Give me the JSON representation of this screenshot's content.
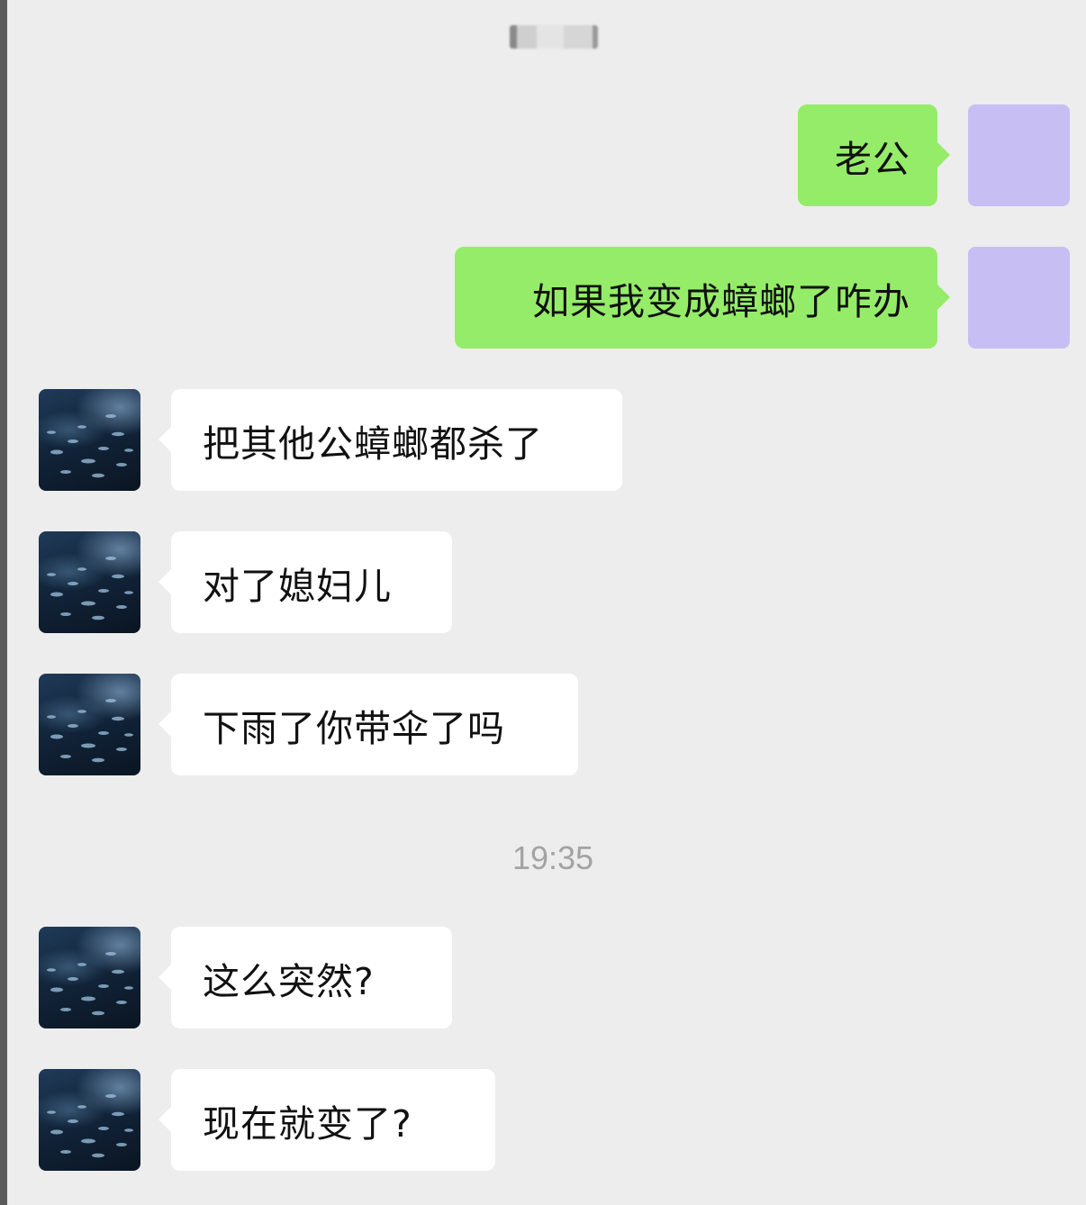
{
  "chat": {
    "timestamp": "19:35",
    "messages": [
      {
        "sender": "self",
        "text": "老公"
      },
      {
        "sender": "self",
        "text": "如果我变成蟑螂了咋办"
      },
      {
        "sender": "other",
        "text": "把其他公蟑螂都杀了"
      },
      {
        "sender": "other",
        "text": "对了媳妇儿"
      },
      {
        "sender": "other",
        "text": "下雨了你带伞了吗"
      },
      {
        "sender": "other",
        "text": "这么突然?"
      },
      {
        "sender": "other",
        "text": "现在就变了?"
      }
    ]
  },
  "colors": {
    "background": "#ededed",
    "self_bubble": "#95ec69",
    "other_bubble": "#ffffff",
    "self_avatar": "#c7bff3",
    "timestamp_text": "#a3a3a3"
  },
  "icons": {
    "self_avatar": "purple-square-avatar",
    "other_avatar": "fish-school-avatar"
  }
}
